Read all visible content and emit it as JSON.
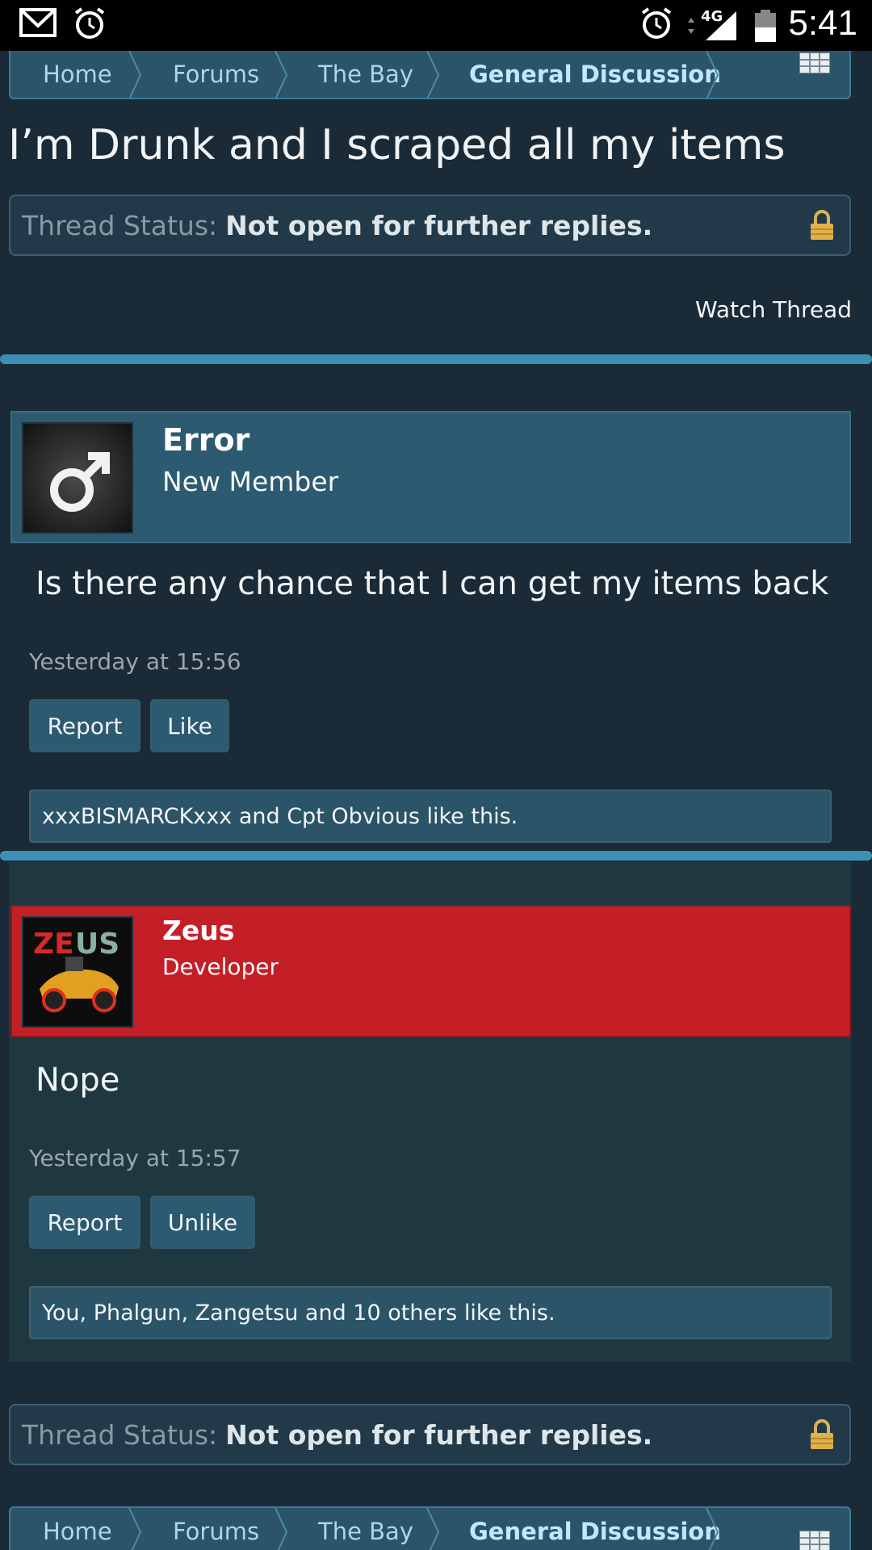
{
  "status_bar": {
    "time": "5:41",
    "network": "4G"
  },
  "breadcrumb": {
    "items": [
      "Home",
      "Forums",
      "The Bay",
      "General Discussion"
    ]
  },
  "thread": {
    "title": "I’m Drunk and I scraped all my items",
    "status_label": "Thread Status:",
    "status_value": "Not open for further replies.",
    "watch_label": "Watch Thread"
  },
  "posts": [
    {
      "username": "Error",
      "user_title": "New Member",
      "message": "Is there any chance that I can get my items back",
      "date": "Yesterday at 15:56",
      "report_label": "Report",
      "like_label": "Like",
      "likes_text": "xxxBISMARCKxxx and Cpt Obvious like this."
    },
    {
      "username": "Zeus",
      "user_title": "Developer",
      "avatar_text": "ZEUS",
      "message": "Nope",
      "date": "Yesterday at 15:57",
      "report_label": "Report",
      "like_label": "Unlike",
      "likes_text": "You, Phalgun, Zangetsu and 10 others like this."
    }
  ],
  "colors": {
    "background": "#1a2a36",
    "accent": "#3d90b5",
    "developer": "#c41f27",
    "panel": "#2c5a70"
  }
}
